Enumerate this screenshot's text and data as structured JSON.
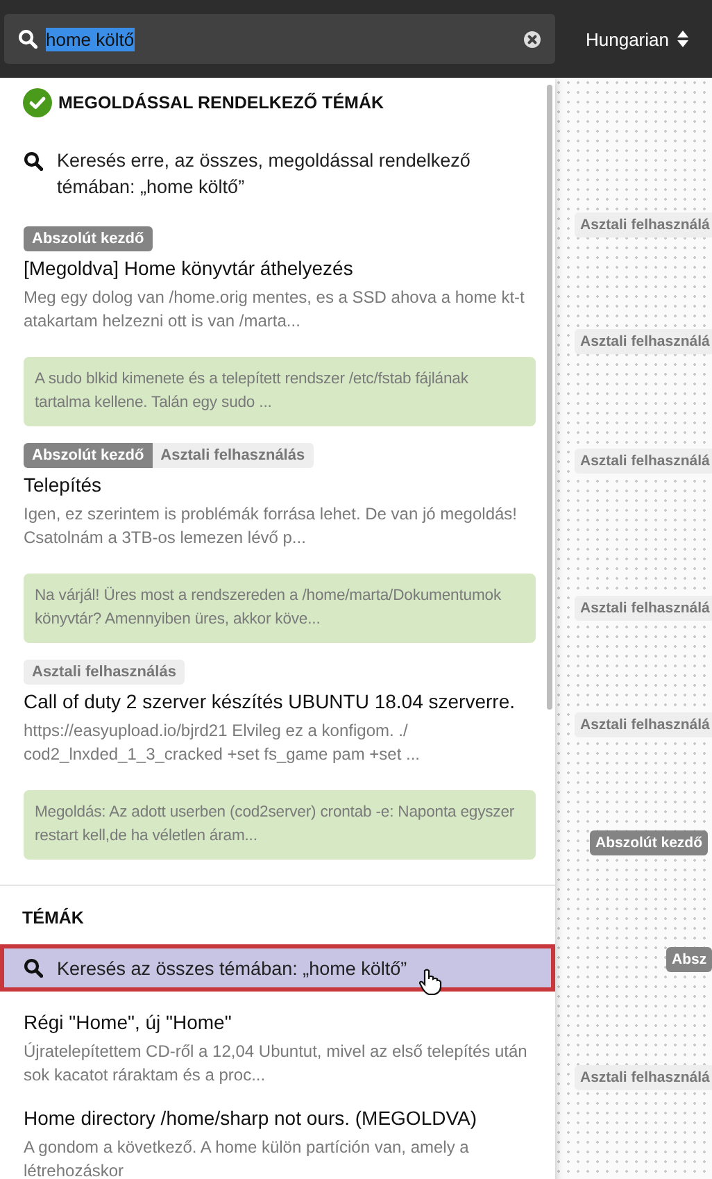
{
  "search": {
    "value": "home költő",
    "language": "Hungarian"
  },
  "solved_section": {
    "heading": "MEGOLDÁSSAL RENDELKEZŐ TÉMÁK",
    "search_row": {
      "text": "Keresés erre, az összes, megoldással rendelkező témában: „home költő”",
      "selected": false
    },
    "results": [
      {
        "tags": [
          {
            "label": "Abszolút kezdő",
            "kind": "dark"
          }
        ],
        "title": "[Megoldva] Home könyvtár áthelyezés",
        "excerpt": "Meg egy dolog van /home.orig mentes, es a SSD ahova a home kt-t atakartam helzezni ott is van /marta...",
        "solution": "A sudo blkid kimenete és a telepített rendszer /etc/fstab fájlának tartalma kellene. Talán egy sudo ..."
      },
      {
        "tags": [
          {
            "label": "Abszolút kezdő",
            "kind": "dark"
          },
          {
            "label": "Asztali felhasználás",
            "kind": "light"
          }
        ],
        "title": "Telepítés",
        "excerpt": "Igen, ez szerintem is problémák forrása lehet. De van jó megoldás! Csatolnám a 3TB-os lemezen lévő p...",
        "solution": "Na várjál! Üres most a rendszereden a /home/marta/Dokumentumok könyvtár? Amennyiben üres, akkor köve..."
      },
      {
        "tags": [
          {
            "label": "Asztali felhasználás",
            "kind": "light"
          }
        ],
        "title": "Call of duty 2 szerver készítés UBUNTU 18.04 szerverre.",
        "excerpt": "https://easyupload.io/bjrd21 Elvileg ez a konfigom. ./ cod2_lnxded_1_3_cracked +set fs_game pam +set ...",
        "solution": "Megoldás: Az adott userben (cod2server) crontab -e: Naponta egyszer restart kell,de ha véletlen áram..."
      }
    ]
  },
  "topics_section": {
    "heading": "TÉMÁK",
    "search_row": {
      "text": "Keresés az összes témában: „home költő”",
      "selected": true
    },
    "results": [
      {
        "title": "Régi \"Home\", új \"Home\"",
        "excerpt": "Újratelepítettem CD-ről a 12,04 Ubuntut, mivel az első telepítés után sok kacatot ráraktam és a proc..."
      },
      {
        "title": "Home directory /home/sharp not ours. (MEGOLDVA)",
        "excerpt": "A gondom a következő. A home külön partíción van, amely a létrehozáskor"
      }
    ]
  },
  "background_tags": [
    {
      "label": "Asztali felhasználá",
      "kind": "light"
    },
    {
      "label": "Asztali felhasználá",
      "kind": "light"
    },
    {
      "label": "Asztali felhasználá",
      "kind": "light"
    },
    {
      "label": "Asztali felhasználá",
      "kind": "light"
    },
    {
      "label": "Asztali felhasználá",
      "kind": "light"
    },
    {
      "label": "Abszolút kezdő",
      "kind": "dark"
    },
    {
      "label": "Absz",
      "kind": "dark"
    },
    {
      "label": "Asztali felhasználá",
      "kind": "light"
    }
  ]
}
